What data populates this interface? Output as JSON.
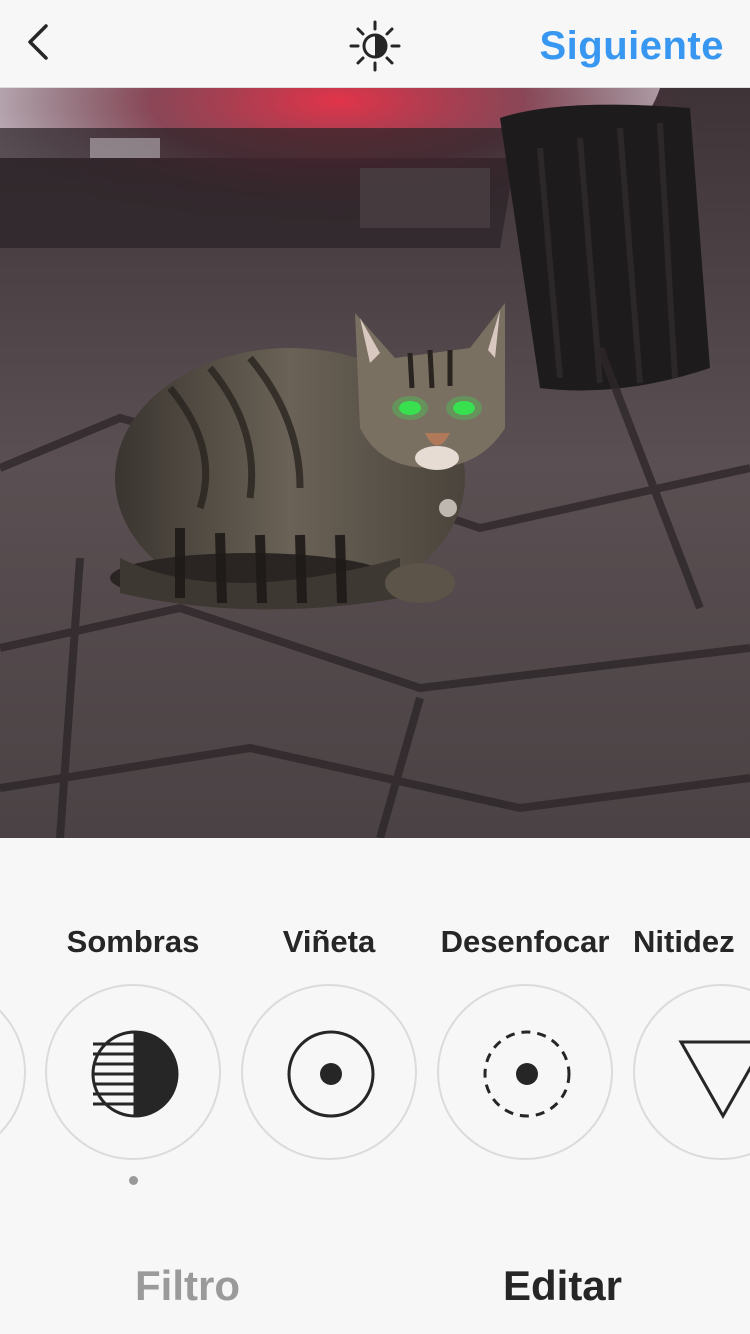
{
  "header": {
    "back_icon": "chevron-left-icon",
    "lux_icon": "lux-sun-icon",
    "next_label": "Siguiente",
    "accent_color": "#3897f0"
  },
  "photo": {
    "subject": "tabby cat under car at night"
  },
  "tools": [
    {
      "label": "",
      "icon": "partial-tool-icon"
    },
    {
      "label": "Sombras",
      "icon": "shadows-icon",
      "active": true
    },
    {
      "label": "Viñeta",
      "icon": "vignette-icon"
    },
    {
      "label": "Desenfocar",
      "icon": "tilt-shift-icon"
    },
    {
      "label": "Nitidez",
      "icon": "sharpen-icon"
    }
  ],
  "tabs": {
    "filter_label": "Filtro",
    "edit_label": "Editar",
    "active": "Editar"
  }
}
